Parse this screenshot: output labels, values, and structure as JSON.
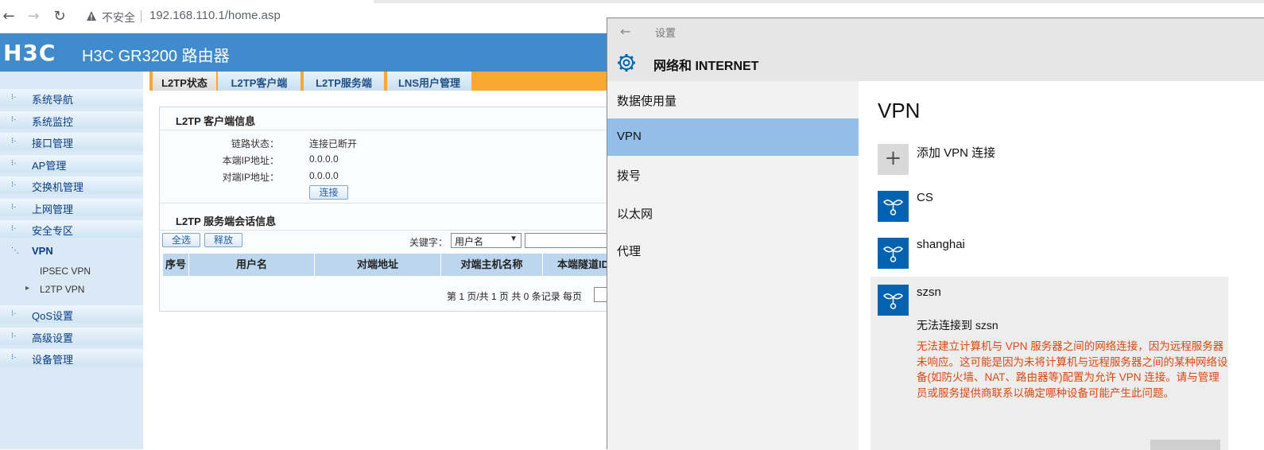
{
  "browser": {
    "insecure_label": "不安全",
    "url": "192.168.110.1/home.asp"
  },
  "router": {
    "logo_text": "H3C",
    "title": "H3C GR3200 路由器",
    "sidebar": {
      "items": [
        {
          "label": "系统导航"
        },
        {
          "label": "系统监控"
        },
        {
          "label": "接口管理"
        },
        {
          "label": "AP管理"
        },
        {
          "label": "交换机管理"
        },
        {
          "label": "上网管理"
        },
        {
          "label": "安全专区"
        },
        {
          "label": "VPN"
        },
        {
          "label": "QoS设置"
        },
        {
          "label": "高级设置"
        },
        {
          "label": "设备管理"
        }
      ],
      "vpn_sub": [
        "IPSEC VPN",
        "L2TP VPN"
      ]
    },
    "tabs": [
      "L2TP状态",
      "L2TP客户端",
      "L2TP服务端",
      "LNS用户管理"
    ],
    "client_info": {
      "title": "L2TP 客户端信息",
      "link_state_label": "链路状态：",
      "link_state_value": "连接已断开",
      "local_ip_label": "本端IP地址：",
      "local_ip_value": "0.0.0.0",
      "peer_ip_label": "对端IP地址：",
      "peer_ip_value": "0.0.0.0",
      "connect_button": "连接"
    },
    "server_info": {
      "title": "L2TP 服务端会话信息",
      "select_all_button": "全选",
      "release_button": "释放",
      "keyword_label": "关键字：",
      "keyword_select": "用户名",
      "columns": [
        "序号",
        "用户名",
        "对端地址",
        "对端主机名称",
        "本端隧道ID"
      ],
      "pager": "第 1 页/共 1 页 共 0 条记录 每页"
    }
  },
  "settings": {
    "window_title": "设置",
    "section": "网络和 INTERNET",
    "nav": [
      "数据使用量",
      "VPN",
      "拨号",
      "以太网",
      "代理"
    ],
    "selected_nav": "VPN",
    "page_title": "VPN",
    "add_vpn": "添加 VPN 连接",
    "connections": [
      "CS",
      "shanghai",
      "szsn"
    ],
    "error_title": "无法连接到 szsn",
    "error_text": "无法建立计算机与 VPN 服务器之间的网络连接，因为远程服务器未响应。这可能是因为未将计算机与远程服务器之间的某种网络设备(如防火墙、NAT、路由器等)配置为允许 VPN 连接。请与管理员或服务提供商联系以确定哪种设备可能产生此问题。",
    "error_color": "#e0460f",
    "accent_color": "#0063b1"
  }
}
